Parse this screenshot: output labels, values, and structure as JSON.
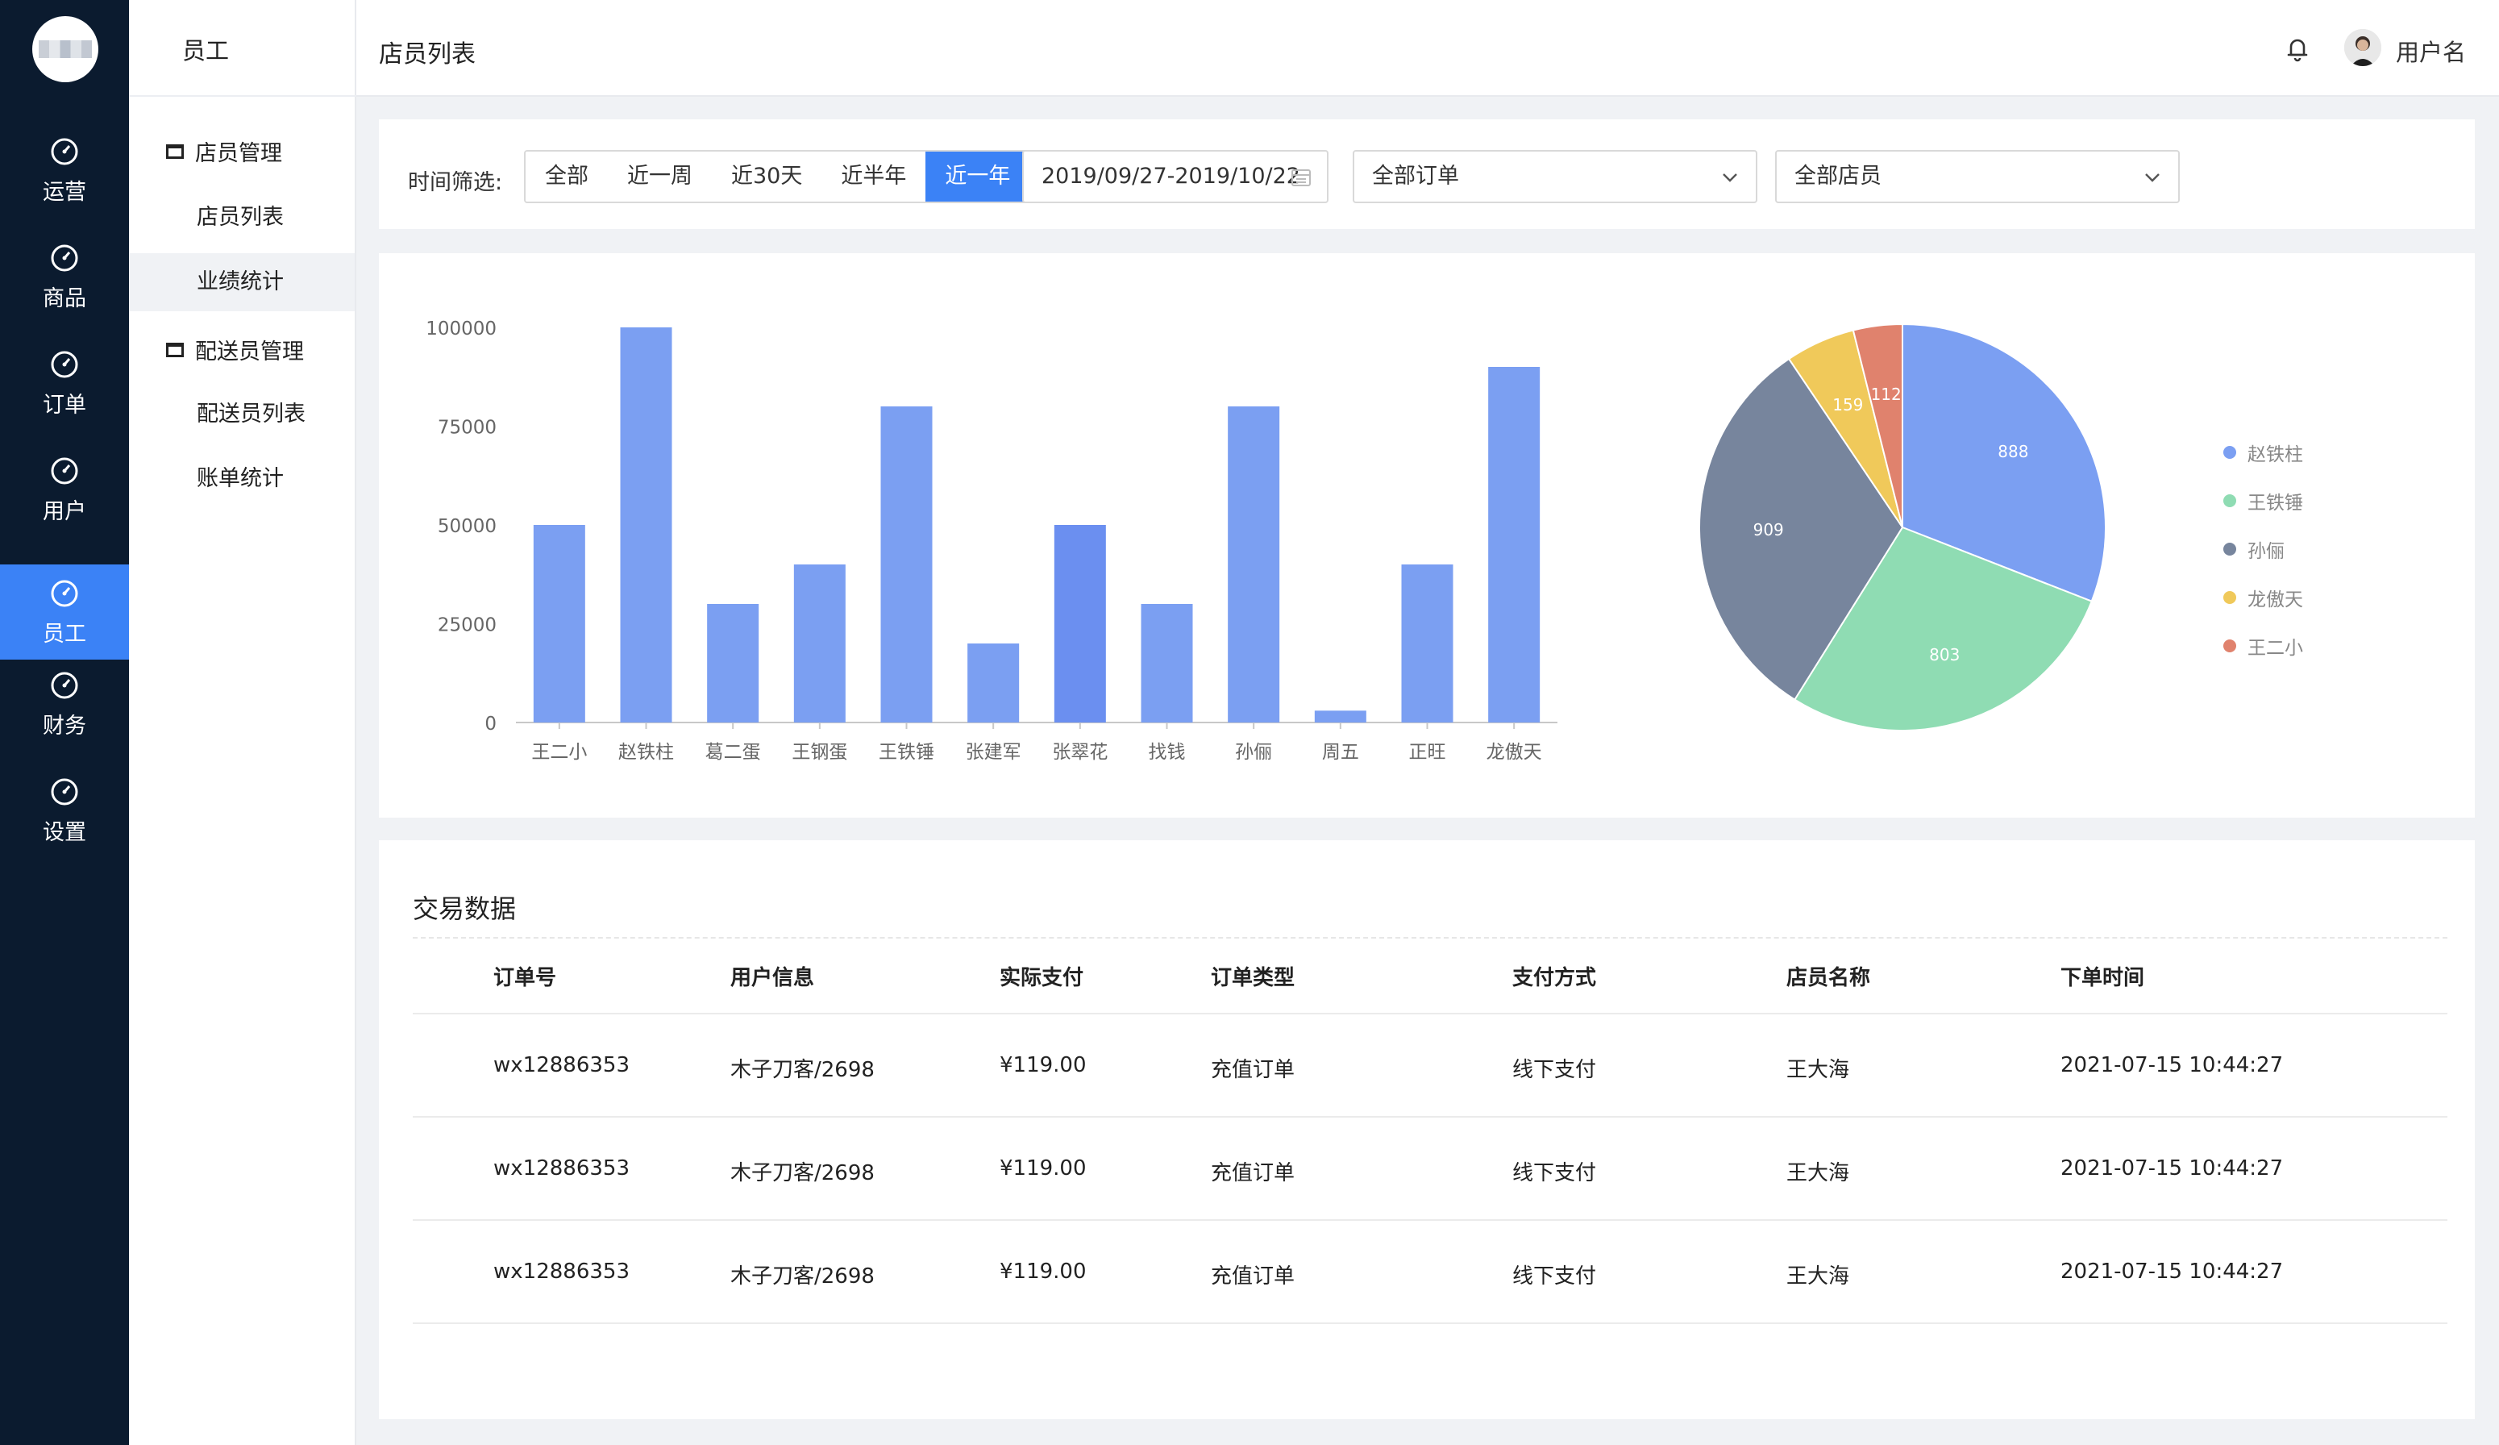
{
  "nav": {
    "items": [
      {
        "label": "运营",
        "icon": "dashboard-icon",
        "active": false
      },
      {
        "label": "商品",
        "icon": "dashboard-icon",
        "active": false
      },
      {
        "label": "订单",
        "icon": "dashboard-icon",
        "active": false
      },
      {
        "label": "用户",
        "icon": "dashboard-icon",
        "active": false
      },
      {
        "label": "员工",
        "icon": "dashboard-icon",
        "active": true
      },
      {
        "label": "财务",
        "icon": "dashboard-icon",
        "active": false
      },
      {
        "label": "设置",
        "icon": "dashboard-icon",
        "active": false
      }
    ]
  },
  "sidebar": {
    "title": "员工",
    "groups": [
      {
        "label": "店员管理",
        "items": [
          "店员列表",
          "业绩统计"
        ]
      },
      {
        "label": "配送员管理",
        "items": [
          "配送员列表",
          "账单统计"
        ]
      }
    ],
    "active_item": "业绩统计"
  },
  "header": {
    "title": "店员列表",
    "username": "用户名"
  },
  "filters": {
    "label": "时间筛选:",
    "ranges": [
      "全部",
      "近一周",
      "近30天",
      "近半年",
      "近一年"
    ],
    "active_range": "近一年",
    "date_range": "2019/09/27-2019/10/22",
    "order_type": "全部订单",
    "staff": "全部店员"
  },
  "colors": {
    "accent": "#3b82f6",
    "bar": "#7b9ff2",
    "bar_highlight": "#6b8ff0"
  },
  "chart_data": [
    {
      "type": "bar",
      "categories": [
        "王二小",
        "赵铁柱",
        "葛二蛋",
        "王钢蛋",
        "王铁锤",
        "张建军",
        "张翠花",
        "找钱",
        "孙俪",
        "周五",
        "正旺",
        "龙傲天"
      ],
      "values": [
        50000,
        100000,
        30000,
        40000,
        80000,
        20000,
        50000,
        30000,
        80000,
        3000,
        40000,
        90000
      ],
      "y_ticks": [
        "100000",
        "75000",
        "50000",
        "25000",
        "0"
      ],
      "ylim": [
        0,
        100000
      ]
    },
    {
      "type": "pie",
      "slices": [
        {
          "label": "赵铁柱",
          "value": 888,
          "color": "#7b9ff2"
        },
        {
          "label": "王铁锤",
          "value": 803,
          "color": "#8fdcb3"
        },
        {
          "label": "孙俪",
          "value": 909,
          "color": "#77859d"
        },
        {
          "label": "龙傲天",
          "value": 159,
          "color": "#f0c95a"
        },
        {
          "label": "王二小",
          "value": 112,
          "color": "#e0826d"
        }
      ],
      "legend_position": "right"
    }
  ],
  "transactions": {
    "title": "交易数据",
    "columns": [
      "订单号",
      "用户信息",
      "实际支付",
      "订单类型",
      "支付方式",
      "店员名称",
      "下单时间"
    ],
    "rows": [
      [
        "wx12886353",
        "木子刀客/2698",
        "¥119.00",
        "充值订单",
        "线下支付",
        "王大海",
        "2021-07-15 10:44:27"
      ],
      [
        "wx12886353",
        "木子刀客/2698",
        "¥119.00",
        "充值订单",
        "线下支付",
        "王大海",
        "2021-07-15 10:44:27"
      ],
      [
        "wx12886353",
        "木子刀客/2698",
        "¥119.00",
        "充值订单",
        "线下支付",
        "王大海",
        "2021-07-15 10:44:27"
      ]
    ]
  }
}
